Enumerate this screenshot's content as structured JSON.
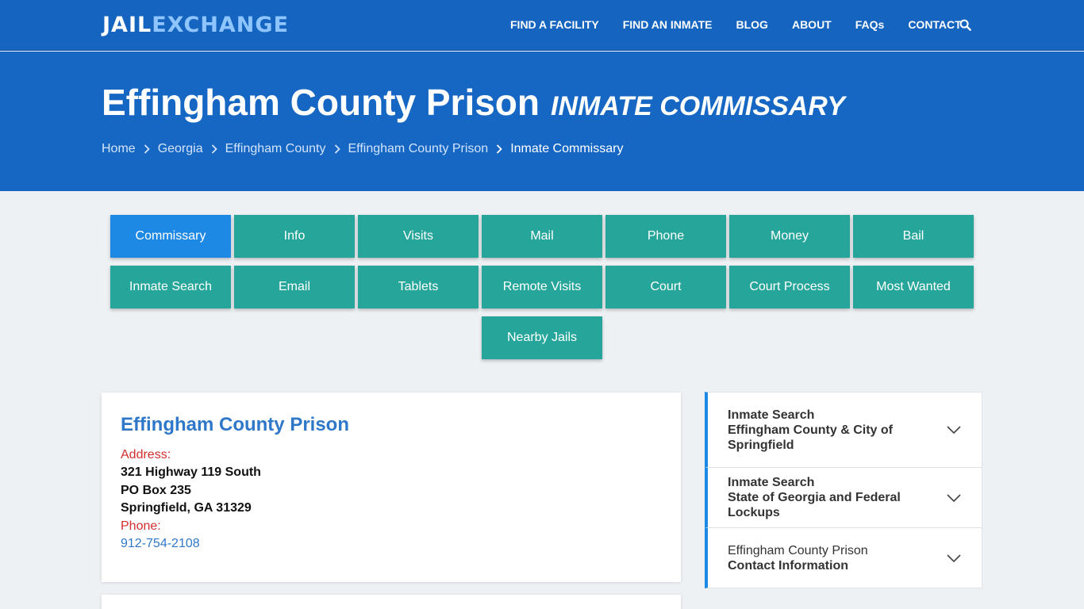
{
  "brand": {
    "part1": "JAIL",
    "part2": "EXCHANGE"
  },
  "nav": [
    {
      "label": "FIND A FACILITY"
    },
    {
      "label": "FIND AN INMATE"
    },
    {
      "label": "BLOG"
    },
    {
      "label": "ABOUT"
    },
    {
      "label": "FAQs"
    },
    {
      "label": "CONTACT"
    }
  ],
  "hero": {
    "title": "Effingham County Prison",
    "subtitle": "INMATE COMMISSARY"
  },
  "breadcrumb": [
    {
      "label": "Home"
    },
    {
      "label": "Georgia"
    },
    {
      "label": "Effingham County"
    },
    {
      "label": "Effingham County Prison"
    },
    {
      "label": "Inmate Commissary"
    }
  ],
  "tabs": {
    "row1": [
      "Commissary",
      "Info",
      "Visits",
      "Mail",
      "Phone",
      "Money",
      "Bail"
    ],
    "row2": [
      "Inmate Search",
      "Email",
      "Tablets",
      "Remote Visits",
      "Court",
      "Court Process",
      "Most Wanted"
    ],
    "row3": [
      "Nearby Jails"
    ]
  },
  "facility": {
    "name": "Effingham County Prison",
    "address_label": "Address:",
    "address_line1": "321 Highway 119 South",
    "address_line2": "PO Box 235",
    "address_line3": "Springfield, GA 31329",
    "phone_label": "Phone:",
    "phone": "912-754-2108"
  },
  "accordion": [
    {
      "line1": "Inmate Search",
      "line2": "Effingham County & City of Springfield"
    },
    {
      "line1": "Inmate Search",
      "line2": "State of Georgia and Federal Lockups"
    },
    {
      "line1": "Effingham County Prison",
      "line2": "Contact Information"
    }
  ],
  "colors": {
    "navbar": "#1565c0",
    "hero": "#1667c4",
    "tab": "#26a69a",
    "tab_active": "#1e88e5",
    "link": "#2f78c9",
    "label_red": "#d32f2f"
  }
}
